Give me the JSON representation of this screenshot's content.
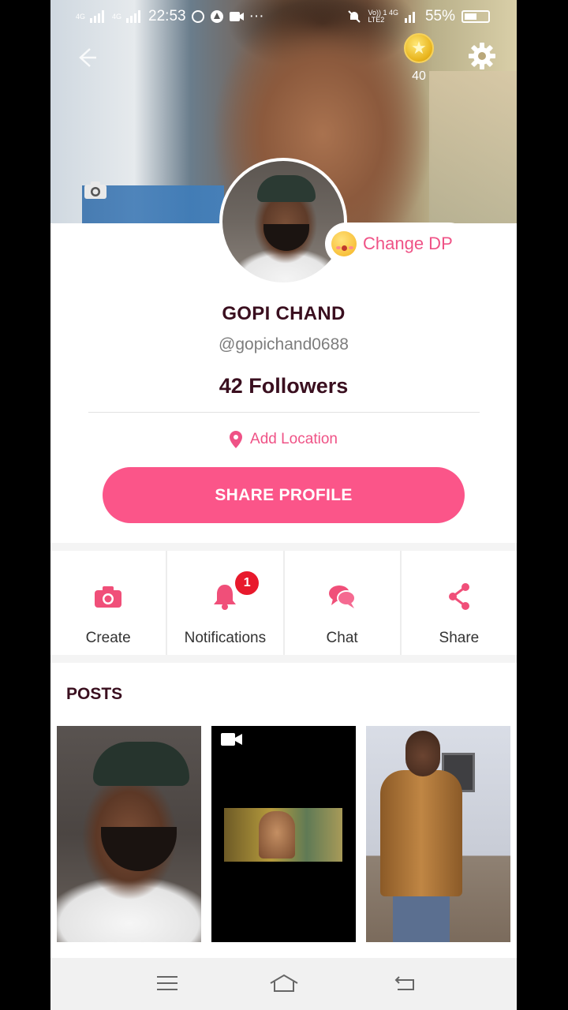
{
  "status_bar": {
    "network_left": "4G",
    "network_left2": "4G",
    "time": "22:53",
    "lte_label_top": "Vo)) 1 4G",
    "lte_label_bottom": "LTE2",
    "battery": "55%",
    "battery_level": 0.55
  },
  "header": {
    "coin_count": "40"
  },
  "profile": {
    "change_dp_label": "Change DP",
    "name": "GOPI CHAND",
    "handle": "@gopichand0688",
    "followers": "42 Followers",
    "location_label": "Add Location",
    "share_button": "SHARE PROFILE"
  },
  "actions": [
    {
      "label": "Create",
      "icon": "camera-icon"
    },
    {
      "label": "Notifications",
      "icon": "bell-icon",
      "badge": "1"
    },
    {
      "label": "Chat",
      "icon": "chat-icon"
    },
    {
      "label": "Share",
      "icon": "share-icon"
    }
  ],
  "posts": {
    "title": "POSTS"
  },
  "colors": {
    "accent": "#fb5589",
    "accent_text": "#ef5286",
    "title_text": "#3a0f1f",
    "badge": "#e8192c"
  }
}
